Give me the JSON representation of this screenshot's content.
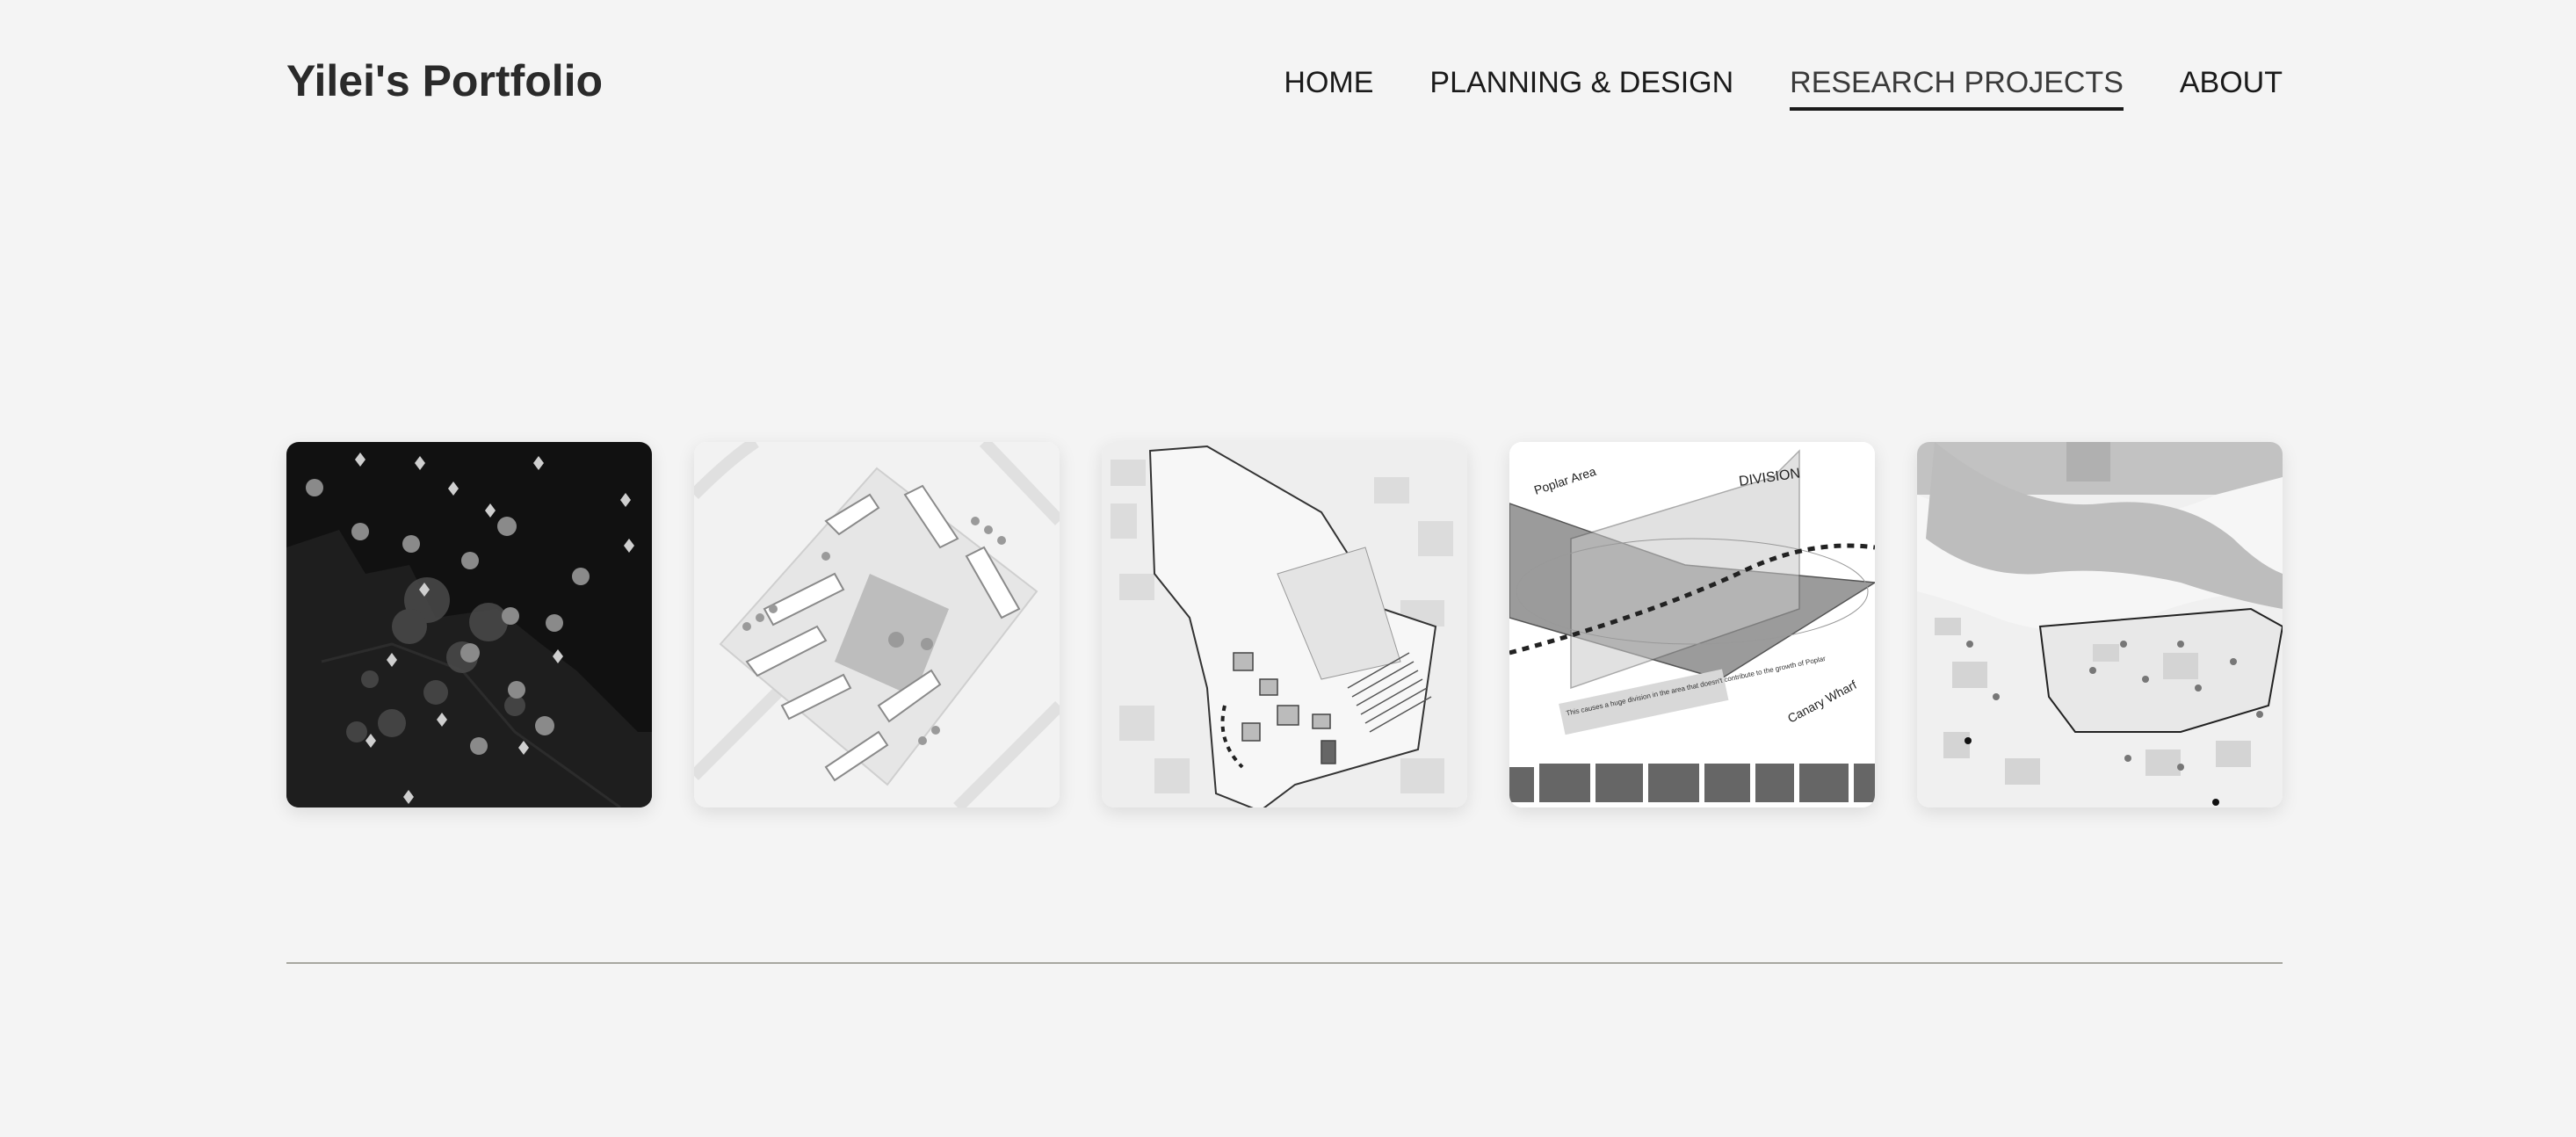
{
  "site": {
    "title": "Yilei's Portfolio"
  },
  "nav": {
    "items": [
      {
        "label": "HOME"
      },
      {
        "label": "PLANNING & DESIGN"
      },
      {
        "label": "RESEARCH PROJECTS",
        "active": true
      },
      {
        "label": "ABOUT"
      }
    ]
  },
  "gallery": {
    "cards": [
      {
        "name": "dark-heatmap-map",
        "labels": []
      },
      {
        "name": "courtyard-masterplan",
        "labels": []
      },
      {
        "name": "site-boundary-plan",
        "labels": []
      },
      {
        "name": "axonometric-diagram",
        "labels": [
          "Poplar Area",
          "DIVISION",
          "Canary Wharf",
          "This causes a huge division in the area that doesn't contribute to the growth of Poplar"
        ]
      },
      {
        "name": "river-district-map",
        "labels": []
      }
    ]
  },
  "colors": {
    "background": "#f4f4f4",
    "text": "#222222",
    "divider": "#a7a7a0",
    "active_underline": "#1a1a1a"
  }
}
